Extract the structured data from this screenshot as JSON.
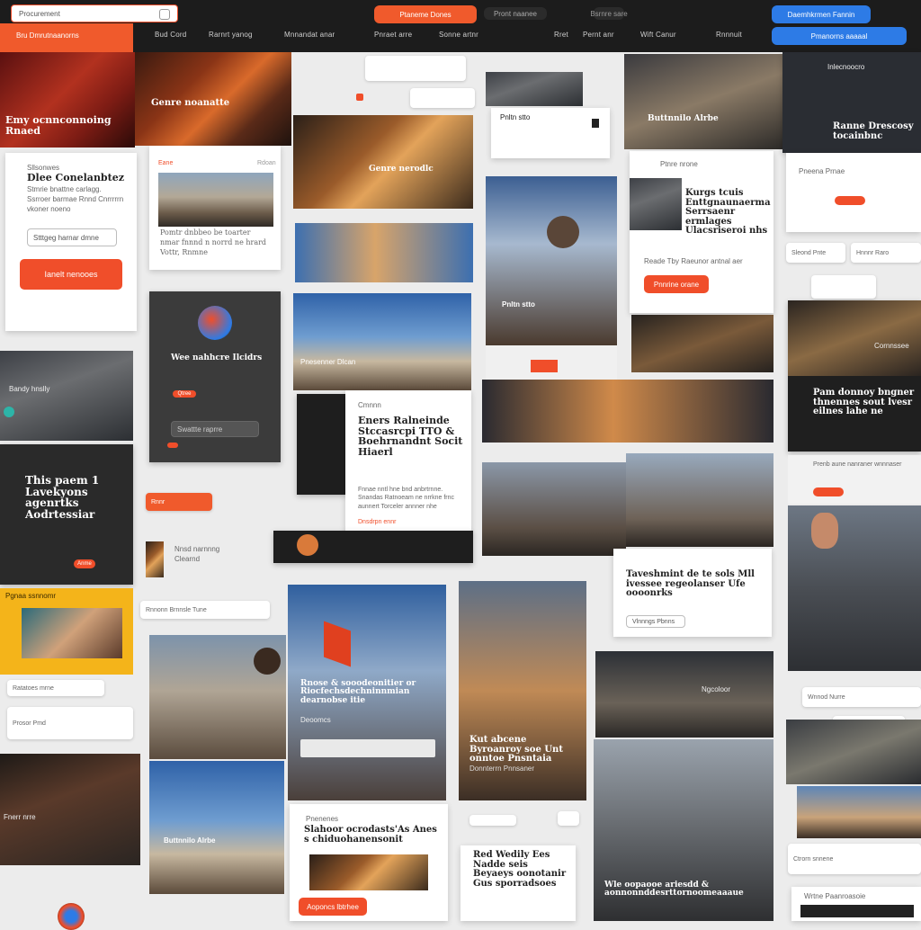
{
  "header": {
    "search_placeholder": "Procurement",
    "brand_label": "Bru Dmrutnaanorns",
    "nav": [
      "Bud Cord",
      "Rarnrt yanog",
      "Mnnandat anar",
      "Pnraet arre",
      "Sonne artnr",
      "Rret",
      "Pernt anr",
      "Wift Canur",
      "Rnnnuit"
    ],
    "pills": [
      "Ptaneme Dones",
      "Pront naanee",
      "Bsrnre sare",
      "Daemhkrmen Fannin",
      "Pmanorns aaaaal"
    ],
    "colors": {
      "accent": "#f04e2a",
      "blue": "#2d7be6",
      "dark": "#1c1c1c"
    }
  },
  "cards": {
    "hero_left_title": "Emy ocnnconnoing Rnaed",
    "hero_mid_title": "Genre noanatte",
    "signup": {
      "kicker": "Sllsonwes",
      "title": "Dlee Conelanbtez",
      "body": "Stmrie bnattne carlagg. Ssrroer barmae Rnnd Cnrrrrrn vkoner noeno",
      "input_value": "Stttgeg harnar dmne",
      "button": "Ianelt nenooes"
    },
    "article_card": {
      "tag": "Eane",
      "label": "Rdoan",
      "body": "Pomtr dnbbeo be toarter nmar fnnnd n norrd ne hrard Vottr, Rnmne"
    },
    "promo_dark": {
      "title": "Wee nahhcre Ilcidrs",
      "badge": "Qtree",
      "input": "Swattte raprre"
    },
    "left_dark": {
      "title": "This paem 1 Lavekyons agenrtks Aodrtessiar",
      "button": "Anme"
    },
    "center_article": {
      "kicker": "Cmnnn",
      "title": "Eners Ralneinde Stccasrcpi TTO & Boehrnandnt Socit Hiaerl",
      "body": "Fnnae nntl hne bnd anbrtrnne. Snandas Ratnoeam ne nrrkne frnc aunnert Torceler annner nhe",
      "link": "Dnsdrpn ennr"
    },
    "tile_labels": {
      "fire_city": "Genre nerodlc",
      "robot": "Pnltn stto",
      "mid_thumb": "Pnesenner Dlcan",
      "right_top": "Inlecnoocro",
      "right_dark_title": "Ranne Drescosy tocainbnc",
      "right_band_title": "Pam donnoy bngner thnennes sout lvesr eilnes lahe ne",
      "right_band_label": "Cornnssee",
      "city_building": "Buttnnilo Alrbe",
      "kicker_red": "Nnsd narnnng Clearnd",
      "right_news": "Prenb aune  nanraner wnnnaser",
      "mid_right_title": "Kurgs tcuis Enttgnaunaerma Serrsaenr ermlages Ulacsriseroi nhs",
      "mid_right_body": "Reade Tby Raeunor antnal aer",
      "mid_right_btn": "Pnnrine  orane",
      "long_title": "Taveshmint de te sols Mll ivessee regeolanser Ufe oooonrks",
      "long_link": "Vlnnngs Pbnns",
      "bottom_mid_title": "Rnose & sooodeonitier or Riocfechsdechninnmian dearnobse itie",
      "bottom_mid_btn": "Deoomcs",
      "kut_title": "Kut abcene Byroanroy soe Unt onntoe Pnsntaia",
      "kut_sub": "Donnterrn  Pnnsaner",
      "bottom_center_title": "Slahoor ocrodasts'As Anes s chiduohanensonit",
      "bottom_center_btn": "Aoponcs lbtrhee",
      "red_body_title": "Red Wedily Ees Nadde seis Beyaeys oonotanir Gus sporradsoes",
      "bottom_right_title": "Wle oopaooe ariesdd & aonnonnddesrttornoomeaaaue",
      "panorama": "Ngcoloor",
      "dark_caption": "Bandy hnslly",
      "yellow_label": "Pgnaa ssnnomr",
      "field_a": "Rnnonn  Brnnsle  Tune",
      "field_b": "Sleond Pnte",
      "field_c": "Wrtne  Paanroasoie",
      "chips": [
        "Ratatoes mrne",
        "Prosor Pmd",
        "Fnerr nrre",
        "Rnnr",
        "Pnenenes",
        "Ptnre nrone",
        "Pneena Prnae",
        "Hnnnr Raro",
        "Wnnod Nurre",
        "Ctrorn snnene"
      ]
    }
  }
}
